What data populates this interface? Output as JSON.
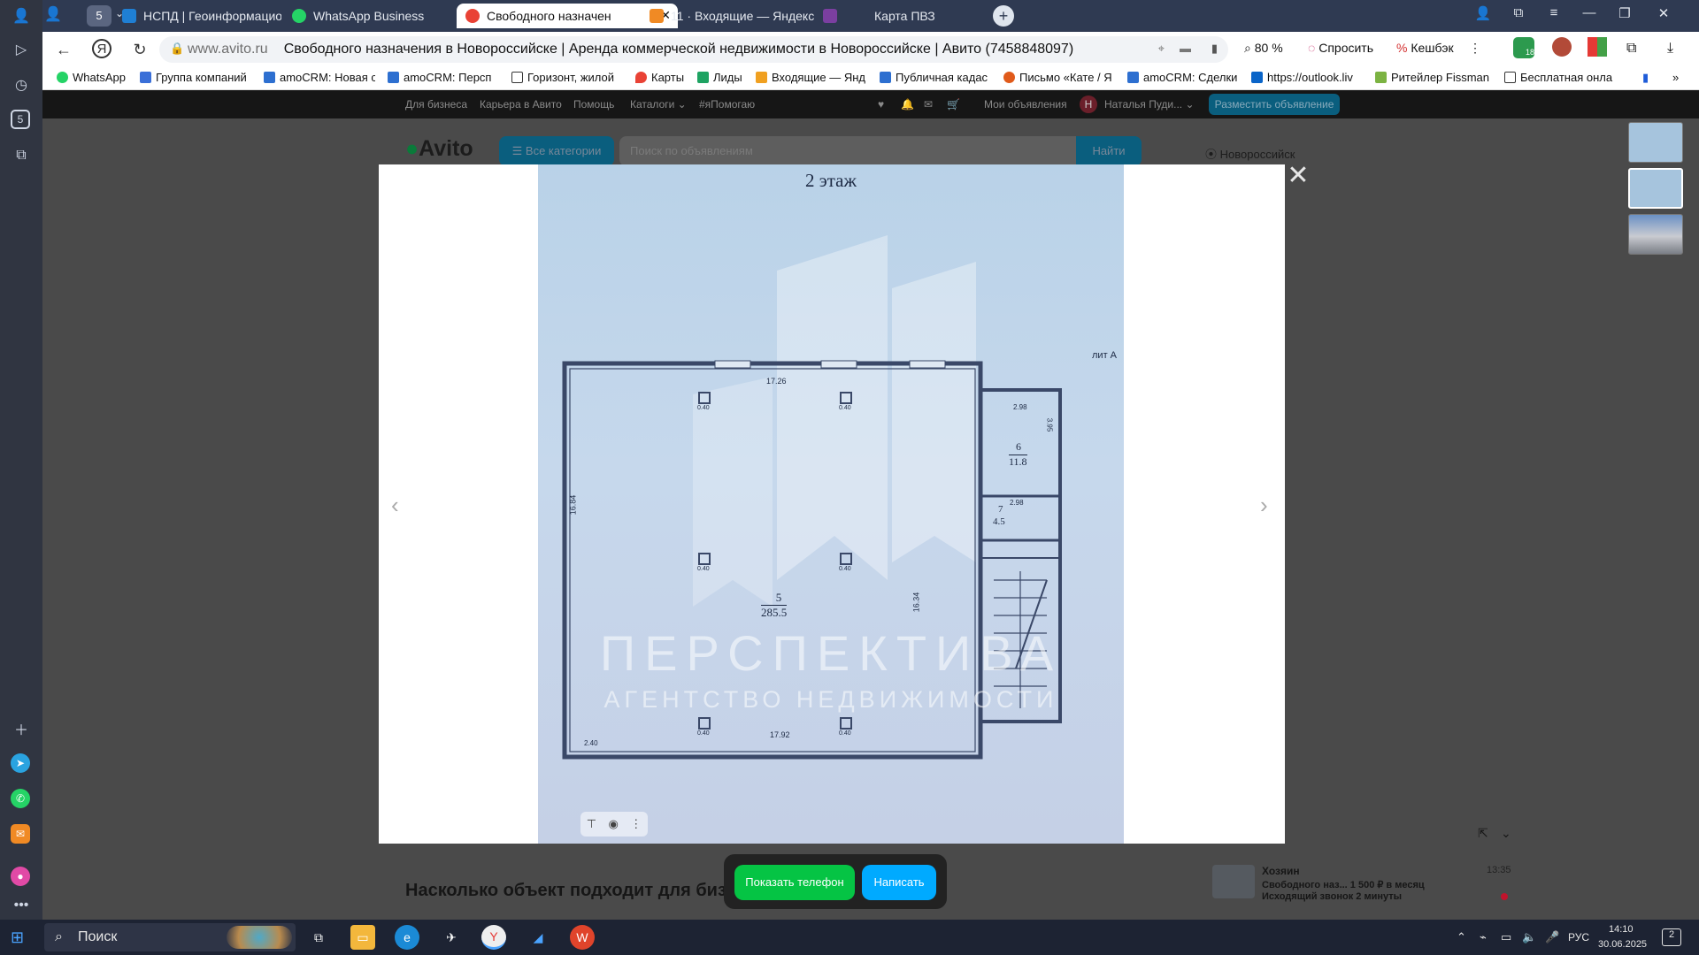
{
  "browser": {
    "tabs": [
      {
        "label": "НСПД | Геоинформацио",
        "icon": "nspd-icon",
        "active": false
      },
      {
        "label": "WhatsApp Business",
        "icon": "whatsapp-icon",
        "active": false
      },
      {
        "label": "Свободного назначен",
        "icon": "avito-icon",
        "active": true
      },
      {
        "label": "11 · Входящие — Яндекс",
        "icon": "mail-icon",
        "active": false
      },
      {
        "label": "Карта ПВЗ",
        "icon": "map-icon",
        "active": false
      }
    ],
    "tab_group_badge": "5",
    "url_domain": "www.avito.ru",
    "page_title": "Свободного назначения в Новороссийске | Аренда коммерческой недвижимости в Новороссийске | Авито (7458848097)",
    "zoom": "80 %",
    "ask_label": "Спросить",
    "cashback_label": "Кешбэк",
    "extensions_badge": "18",
    "sidebar_badge": "5"
  },
  "bookmarks": [
    {
      "label": "WhatsApp",
      "color": "#25d366"
    },
    {
      "label": "Группа компаний",
      "color": "#3a6fd8"
    },
    {
      "label": "amoCRM: Новая с",
      "color": "#2d6fd0"
    },
    {
      "label": "amoCRM: Персп",
      "color": "#2d6fd0"
    },
    {
      "label": "Горизонт, жилой",
      "color": "#888888"
    },
    {
      "label": "Карты",
      "color": "#e94235"
    },
    {
      "label": "Лиды",
      "color": "#1ea362"
    },
    {
      "label": "Входящие — Янд",
      "color": "#f0a020"
    },
    {
      "label": "Публичная кадас",
      "color": "#2d6fd0"
    },
    {
      "label": "Письмо «Кате / Я",
      "color": "#e05a1a"
    },
    {
      "label": "amoCRM: Сделки",
      "color": "#2d6fd0"
    },
    {
      "label": "https://outlook.liv",
      "color": "#0a64c8"
    },
    {
      "label": "Ритейлер Fissman",
      "color": "#7cb342"
    },
    {
      "label": "Бесплатная онла",
      "color": "#888888"
    }
  ],
  "avito": {
    "topnav": [
      "Для бизнеса",
      "Карьера в Авито",
      "Помощь",
      "Каталоги ⌄",
      "#яПомогаю"
    ],
    "my_ads": "Мои объявления",
    "user": "Наталья Пуди... ⌄",
    "post_ad": "Разместить объявление",
    "logo": "Avito",
    "all_categories": "☰ Все категории",
    "search_placeholder": "Поиск по объявлениям",
    "search_button": "Найти",
    "city": "Новороссийск",
    "section_heading": "Насколько объект подходит для биз",
    "chat": {
      "name": "Хозяин",
      "time": "13:35",
      "line1": "Свободного наз... 1 500 ₽ в месяц",
      "line2": "Исходящий звонок 2 минуты"
    }
  },
  "floorplan": {
    "title": "2 этаж",
    "lit": "лит А",
    "watermark_main": "ПЕРСПЕКТИВА",
    "watermark_sub": "АГЕНТСТВО НЕДВИЖИМОСТИ",
    "room5_num": "5",
    "room5_area": "285.5",
    "room6_num": "6",
    "room6_area": "11.8",
    "room7_num": "7",
    "room7_area": "4.5",
    "dim_top": "17.26",
    "dim_left": "16.84",
    "dim_bottom": "17.92",
    "dim_mid": "16.34",
    "dim_r1": "2.98",
    "dim_r2": "2.98",
    "dim_r3": "3.95",
    "dim_small": "2.40",
    "col1": "0.40",
    "col2": "0.40",
    "col3": "0.40",
    "col4": "0.40",
    "col5": "0.40",
    "col6": "0.40"
  },
  "contact": {
    "show_phone": "Показать телефон",
    "write": "Написать"
  },
  "taskbar": {
    "search": "Поиск",
    "lang": "РУС",
    "time": "14:10",
    "date": "30.06.2025",
    "notifications": "2"
  }
}
